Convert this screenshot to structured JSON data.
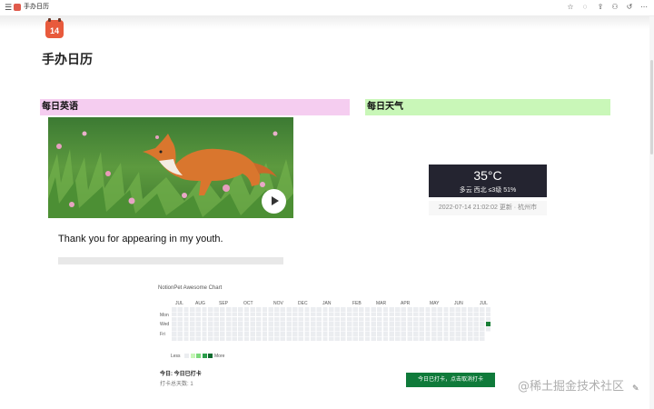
{
  "window": {
    "title": "手办日历",
    "menu_glyph": "☰",
    "toolbar_icons": [
      {
        "name": "star-icon",
        "glyph": "☆"
      },
      {
        "name": "comment-icon",
        "glyph": "◌"
      },
      {
        "name": "share-icon",
        "glyph": "⇪"
      },
      {
        "name": "user-icon",
        "glyph": "⚇"
      },
      {
        "name": "history-icon",
        "glyph": "↺"
      },
      {
        "name": "more-icon",
        "glyph": "⋯"
      }
    ]
  },
  "page": {
    "icon_day": "14",
    "title": "手办日历"
  },
  "english": {
    "header": "每日英语",
    "quote": "Thank you for appearing in my youth."
  },
  "weather": {
    "header": "每日天气",
    "temperature": "35°C",
    "description": "多云 西北 ≤3级 51%",
    "updated": "2022-07-14 21:02:02 更新 · 杭州市"
  },
  "heatmap": {
    "title": "NotionPet Awesome Chart",
    "months": [
      "JUL",
      "AUG",
      "SEP",
      "OCT",
      "NOV",
      "DEC",
      "JAN",
      "FEB",
      "MAR",
      "APR",
      "MAY",
      "JUN",
      "JUL"
    ],
    "day_labels": [
      "Mon",
      "Wed",
      "Fri"
    ],
    "legend_less": "Less",
    "legend_more": "More",
    "legend_colors": [
      "#ebedf0",
      "#c6f5b7",
      "#7bd97a",
      "#2a9d4a",
      "#0f6b2f"
    ],
    "empty_color": "#ebedf0",
    "active_color": "#1a7f37",
    "weeks": 53,
    "active_cells": [
      [
        52,
        3
      ]
    ]
  },
  "checkin": {
    "today": "今日:  今日已打卡",
    "days": "打卡总天数: 1",
    "button": "今日已打卡，点击取消打卡"
  },
  "watermark": "@稀土掘金技术社区",
  "colors": {
    "english_header": "#f5cdf0",
    "weather_header": "#c9f7b8",
    "button_bg": "#0f7a3a"
  }
}
